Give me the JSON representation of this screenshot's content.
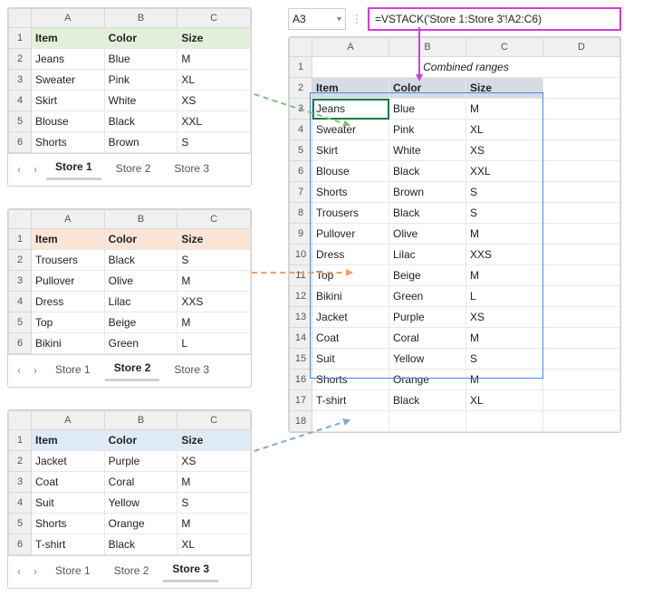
{
  "columns3": [
    "A",
    "B",
    "C"
  ],
  "columns4": [
    "A",
    "B",
    "C",
    "D"
  ],
  "sheets": [
    {
      "tint": "tint-green",
      "active_tab": "Store 1",
      "tabs": [
        "Store 1",
        "Store 2",
        "Store 3"
      ],
      "header": [
        "Item",
        "Color",
        "Size"
      ],
      "rows": [
        [
          "Jeans",
          "Blue",
          "M"
        ],
        [
          "Sweater",
          "Pink",
          "XL"
        ],
        [
          "Skirt",
          "White",
          "XS"
        ],
        [
          "Blouse",
          "Black",
          "XXL"
        ],
        [
          "Shorts",
          "Brown",
          "S"
        ]
      ]
    },
    {
      "tint": "tint-orange",
      "active_tab": "Store 2",
      "tabs": [
        "Store 1",
        "Store 2",
        "Store 3"
      ],
      "header": [
        "Item",
        "Color",
        "Size"
      ],
      "rows": [
        [
          "Trousers",
          "Black",
          "S"
        ],
        [
          "Pullover",
          "Olive",
          "M"
        ],
        [
          "Dress",
          "Lilac",
          "XXS"
        ],
        [
          "Top",
          "Beige",
          "M"
        ],
        [
          "Bikini",
          "Green",
          "L"
        ]
      ]
    },
    {
      "tint": "tint-blue",
      "active_tab": "Store 3",
      "tabs": [
        "Store 1",
        "Store 2",
        "Store 3"
      ],
      "header": [
        "Item",
        "Color",
        "Size"
      ],
      "rows": [
        [
          "Jacket",
          "Purple",
          "XS"
        ],
        [
          "Coat",
          "Coral",
          "M"
        ],
        [
          "Suit",
          "Yellow",
          "S"
        ],
        [
          "Shorts",
          "Orange",
          "M"
        ],
        [
          "T-shirt",
          "Black",
          "XL"
        ]
      ]
    }
  ],
  "right": {
    "namebox": "A3",
    "formula": "=VSTACK('Store 1:Store 3'!A2:C6)",
    "title": "Combined ranges",
    "header": [
      "Item",
      "Color",
      "Size"
    ],
    "rows": [
      [
        "Jeans",
        "Blue",
        "M"
      ],
      [
        "Sweater",
        "Pink",
        "XL"
      ],
      [
        "Skirt",
        "White",
        "XS"
      ],
      [
        "Blouse",
        "Black",
        "XXL"
      ],
      [
        "Shorts",
        "Brown",
        "S"
      ],
      [
        "Trousers",
        "Black",
        "S"
      ],
      [
        "Pullover",
        "Olive",
        "M"
      ],
      [
        "Dress",
        "Lilac",
        "XXS"
      ],
      [
        "Top",
        "Beige",
        "M"
      ],
      [
        "Bikini",
        "Green",
        "L"
      ],
      [
        "Jacket",
        "Purple",
        "XS"
      ],
      [
        "Coat",
        "Coral",
        "M"
      ],
      [
        "Suit",
        "Yellow",
        "S"
      ],
      [
        "Shorts",
        "Orange",
        "M"
      ],
      [
        "T-shirt",
        "Black",
        "XL"
      ]
    ],
    "extra_rows": 1
  }
}
